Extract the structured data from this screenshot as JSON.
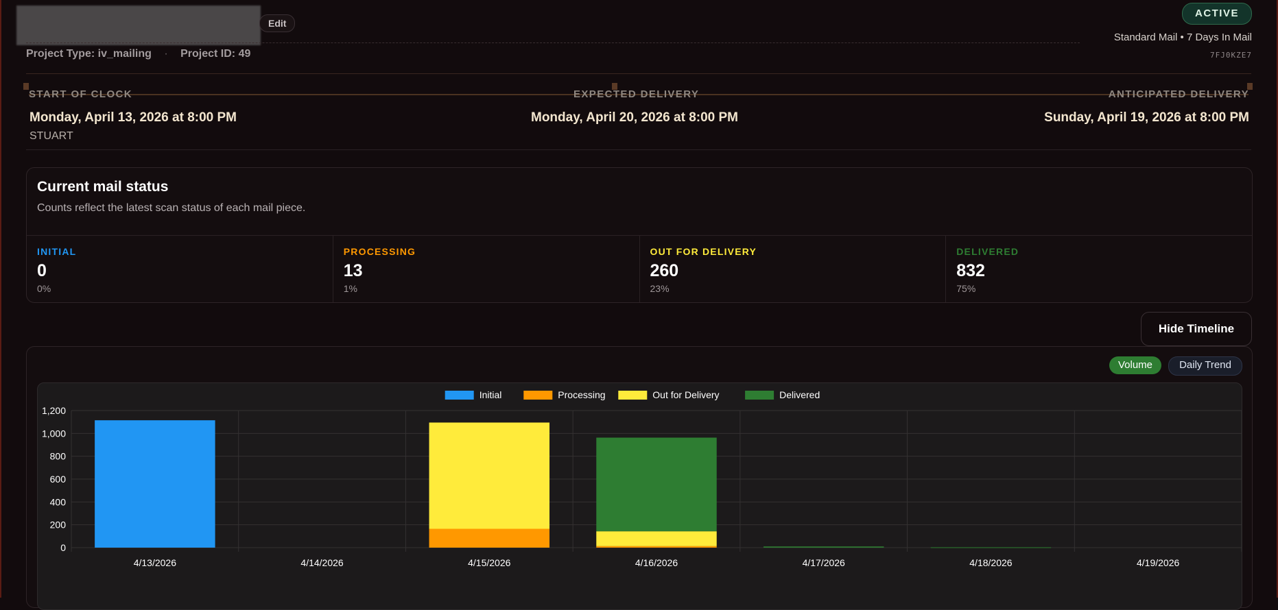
{
  "header": {
    "edit_label": "Edit",
    "project_type_label": "Project Type:",
    "project_type": "iv_mailing",
    "meta_separator": "·",
    "project_id_label": "Project ID:",
    "project_id": "49",
    "status_badge": "ACTIVE",
    "mail_type": "Standard Mail • 7 Days In Mail",
    "code": "7FJ0KZE7"
  },
  "timeline": {
    "start": {
      "label": "START OF CLOCK",
      "date": "Monday, April 13, 2026 at 8:00 PM",
      "sub": "STUART"
    },
    "expected": {
      "label": "EXPECTED DELIVERY",
      "date": "Monday, April 20, 2026 at 8:00 PM"
    },
    "anticipated": {
      "label": "ANTICIPATED DELIVERY",
      "date": "Sunday, April 19, 2026 at 8:00 PM"
    }
  },
  "mail_status": {
    "title": "Current mail status",
    "description": "Counts reflect the latest scan status of each mail piece.",
    "stats": [
      {
        "label": "INITIAL",
        "value": "0",
        "pct": "0%",
        "color": "#2196f3"
      },
      {
        "label": "PROCESSING",
        "value": "13",
        "pct": "1%",
        "color": "#ff9800"
      },
      {
        "label": "OUT FOR DELIVERY",
        "value": "260",
        "pct": "23%",
        "color": "#ffeb3b"
      },
      {
        "label": "DELIVERED",
        "value": "832",
        "pct": "75%",
        "color": "#2e7d32"
      }
    ]
  },
  "controls": {
    "hide_timeline": "Hide Timeline",
    "volume": "Volume",
    "daily_trend": "Daily Trend"
  },
  "chart_data": {
    "type": "bar",
    "stacked": true,
    "categories": [
      "4/13/2026",
      "4/14/2026",
      "4/15/2026",
      "4/16/2026",
      "4/17/2026",
      "4/18/2026",
      "4/19/2026"
    ],
    "series": [
      {
        "name": "Initial",
        "color": "#2196f3",
        "values": [
          1115,
          0,
          0,
          0,
          0,
          0,
          0
        ]
      },
      {
        "name": "Processing",
        "color": "#ff9800",
        "values": [
          0,
          0,
          165,
          13,
          0,
          0,
          0
        ]
      },
      {
        "name": "Out for Delivery",
        "color": "#ffeb3b",
        "values": [
          0,
          0,
          930,
          130,
          0,
          0,
          0
        ]
      },
      {
        "name": "Delivered",
        "color": "#2e7d32",
        "values": [
          0,
          0,
          0,
          820,
          10,
          3,
          0
        ]
      }
    ],
    "ylim": [
      0,
      1200
    ],
    "yticks": [
      0,
      200,
      400,
      600,
      800,
      1000,
      1200
    ],
    "ytick_labels": [
      "0",
      "200",
      "400",
      "600",
      "800",
      "1,000",
      "1,200"
    ],
    "grid": true,
    "legend_position": "top-center"
  }
}
